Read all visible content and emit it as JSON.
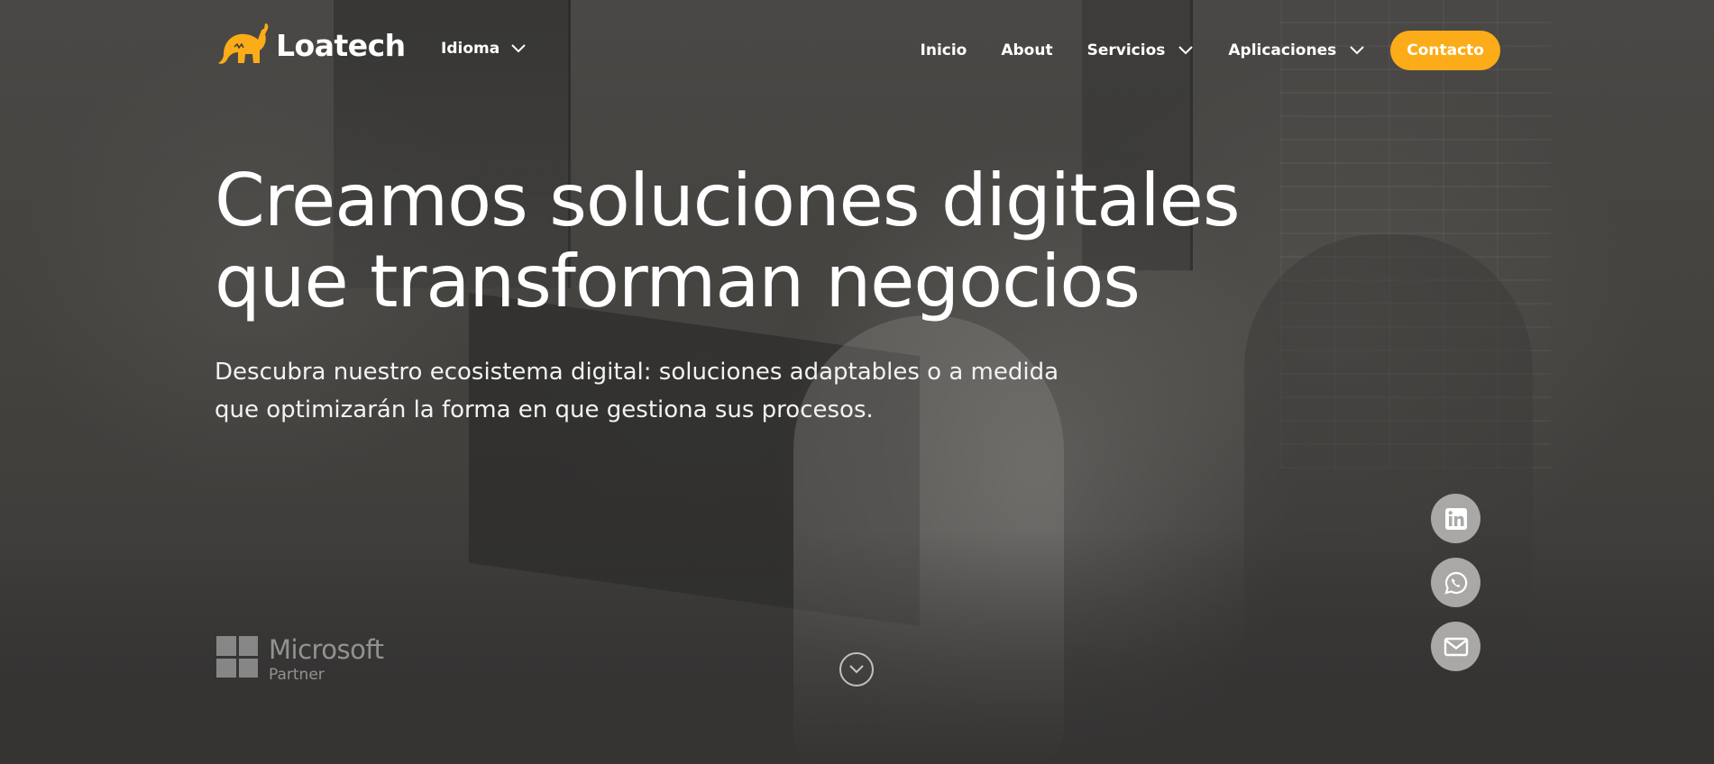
{
  "brand": {
    "name": "Loatech",
    "accent_color": "#fbac18",
    "logo_icon": "elephant-logo-icon"
  },
  "header": {
    "language_label": "Idioma",
    "nav": {
      "inicio": "Inicio",
      "about": "About",
      "servicios": "Servicios",
      "aplicaciones": "Aplicaciones"
    },
    "contact_label": "Contacto"
  },
  "hero": {
    "headline_line1": "Creamos soluciones digitales",
    "headline_line2": "que transforman negocios",
    "subtitle_line1": "Descubra nuestro ecosistema digital: soluciones adaptables o a medida",
    "subtitle_line2": "que optimizarán la forma en que gestiona sus procesos."
  },
  "partner": {
    "name": "Microsoft",
    "tier": "Partner",
    "icon": "microsoft-logo-icon"
  },
  "scroll": {
    "icon": "chevron-down-circle-icon"
  },
  "social": [
    {
      "name": "linkedin",
      "icon": "linkedin-icon"
    },
    {
      "name": "whatsapp",
      "icon": "whatsapp-icon"
    },
    {
      "name": "email",
      "icon": "mail-icon"
    }
  ]
}
